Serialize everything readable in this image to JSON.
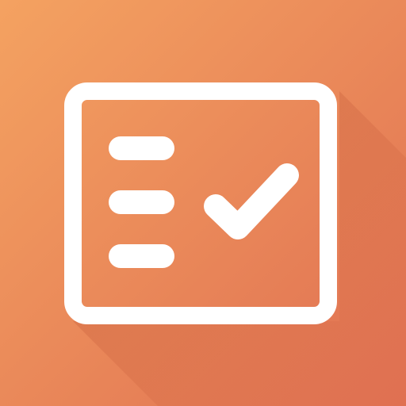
{
  "icon": {
    "name": "checklist-app-icon",
    "glyph": "checklist-icon",
    "colors": {
      "gradient_start": "#F4A261",
      "gradient_end": "#E07052",
      "glyph": "#FFFFFF",
      "shadow": "#B4462A"
    },
    "parts": [
      "frame",
      "list-line",
      "list-line",
      "list-line",
      "checkmark"
    ]
  }
}
